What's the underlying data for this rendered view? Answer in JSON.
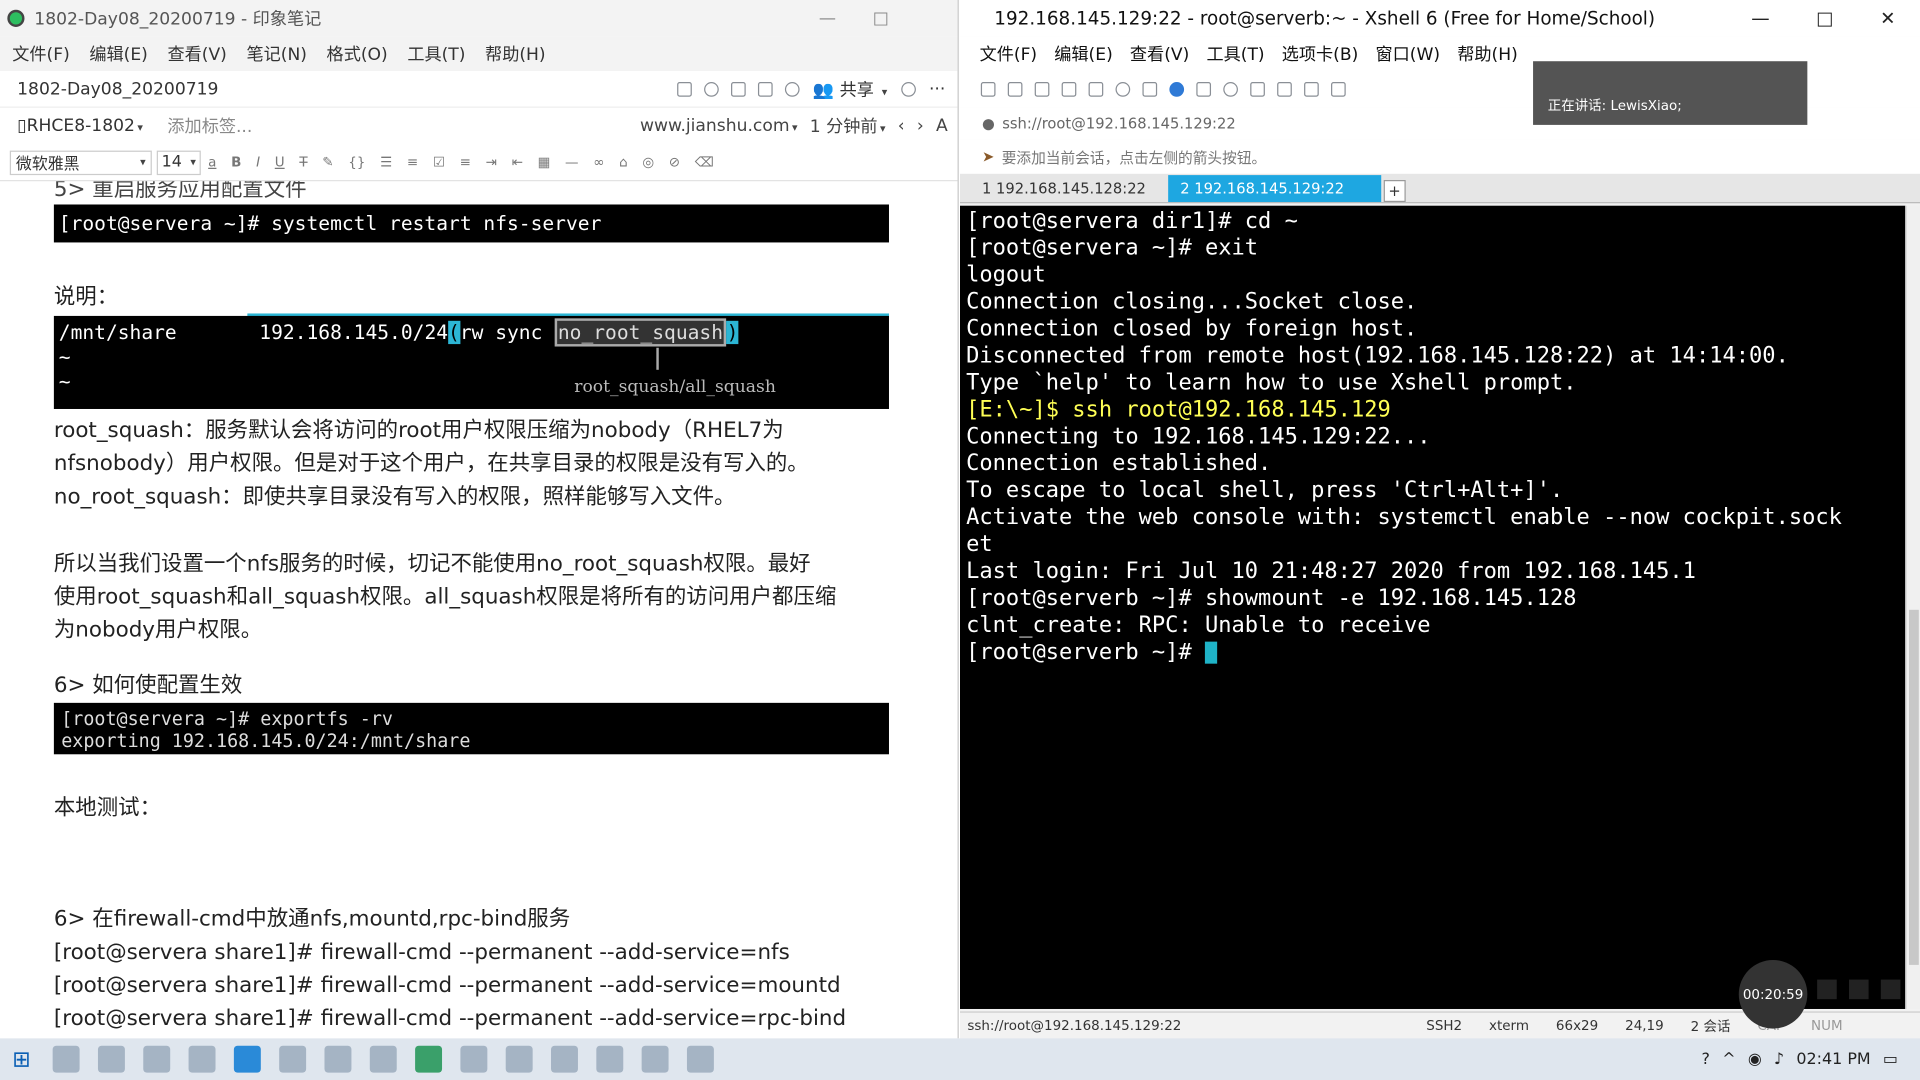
{
  "evernote": {
    "window_title": "1802-Day08_20200719 - 印象笔记",
    "menu": [
      "文件(F)",
      "编辑(E)",
      "查看(V)",
      "笔记(N)",
      "格式(O)",
      "工具(T)",
      "帮助(H)"
    ],
    "note_name": "1802-Day08_20200719",
    "share_label": "共享",
    "notebook": "RHCE8-1802",
    "add_tag": "添加标签...",
    "source_url": "www.jianshu.com",
    "time_ago": "1 分钟前",
    "font_name": "微软雅黑",
    "font_size": "14",
    "content": {
      "heading_restart": "5> 重启服务应用配置文件",
      "cmd_restart": "[root@servera ~]# systemctl restart nfs-server",
      "label_explain": "说明：",
      "exports_path": "/mnt/share",
      "exports_net": "192.168.145.0/24",
      "exports_paren": "(",
      "exports_opts": "rw sync ",
      "exports_noroot": "no_root_squash",
      "exports_paren_close": ")",
      "tilde": "~",
      "annotation": "root_squash/all_squash",
      "p1_line1": "root_squash：服务默认会将访问的root用户权限压缩为nobody（RHEL7为",
      "p1_line2": "nfsnobody）用户权限。但是对于这个用户，在共享目录的权限是没有写入的。",
      "p1_line3": "no_root_squash：即使共享目录没有写入的权限，照样能够写入文件。",
      "p2_line1": "所以当我们设置一个nfs服务的时候，切记不能使用no_root_squash权限。最好",
      "p2_line2": "使用root_squash和all_squash权限。all_squash权限是将所有的访问用户都压缩",
      "p2_line3": "为nobody用户权限。",
      "heading_effect": "6> 如何使配置生效",
      "cmd_exportfs": "[root@servera ~]# exportfs -rv",
      "out_exportfs": "exporting 192.168.145.0/24:/mnt/share",
      "label_local_test": "本地测试：",
      "heading_firewall": "6> 在firewall-cmd中放通nfs,mountd,rpc-bind服务",
      "fw1": "[root@servera share1]# firewall-cmd --permanent --add-service=nfs",
      "fw2": "[root@servera share1]# firewall-cmd --permanent --add-service=mountd",
      "fw3": "[root@servera share1]# firewall-cmd --permanent --add-service=rpc-bind"
    }
  },
  "xshell": {
    "window_title": "192.168.145.129:22 - root@serverb:~ - Xshell 6 (Free for Home/School)",
    "menu": [
      "文件(F)",
      "编辑(E)",
      "查看(V)",
      "工具(T)",
      "选项卡(B)",
      "窗口(W)",
      "帮助(H)"
    ],
    "address": "ssh://root@192.168.145.129:22",
    "hint": "要添加当前会话，点击左侧的箭头按钮。",
    "speaking": "正在讲话: LewisXiao;",
    "tabs": [
      "1 192.168.145.128:22",
      "2 192.168.145.129:22"
    ],
    "terminal": [
      "[root@servera dir1]# cd ~",
      "[root@servera ~]# exit",
      "logout",
      "Connection closing...Socket close.",
      "",
      "Connection closed by foreign host.",
      "",
      "Disconnected from remote host(192.168.145.128:22) at 14:14:00.",
      "",
      "Type `help' to learn how to use Xshell prompt.",
      "[E:\\~]$ ssh root@192.168.145.129",
      "",
      "",
      "Connecting to 192.168.145.129:22...",
      "Connection established.",
      "To escape to local shell, press 'Ctrl+Alt+]'.",
      "",
      "Activate the web console with: systemctl enable --now cockpit.sock",
      "et",
      "",
      "Last login: Fri Jul 10 21:48:27 2020 from 192.168.145.1",
      "[root@serverb ~]# showmount -e 192.168.145.128",
      "clnt_create: RPC: Unable to receive",
      "[root@serverb ~]# "
    ],
    "status": {
      "conn": "ssh://root@192.168.145.129:22",
      "proto": "SSH2",
      "term": "xterm",
      "size": "66x29",
      "pos": "24,19",
      "sessions": "2 会话",
      "cap": "CAP",
      "num": "NUM"
    },
    "recorder_time": "00:20:59"
  },
  "taskbar": {
    "clock": "02:41 PM"
  }
}
